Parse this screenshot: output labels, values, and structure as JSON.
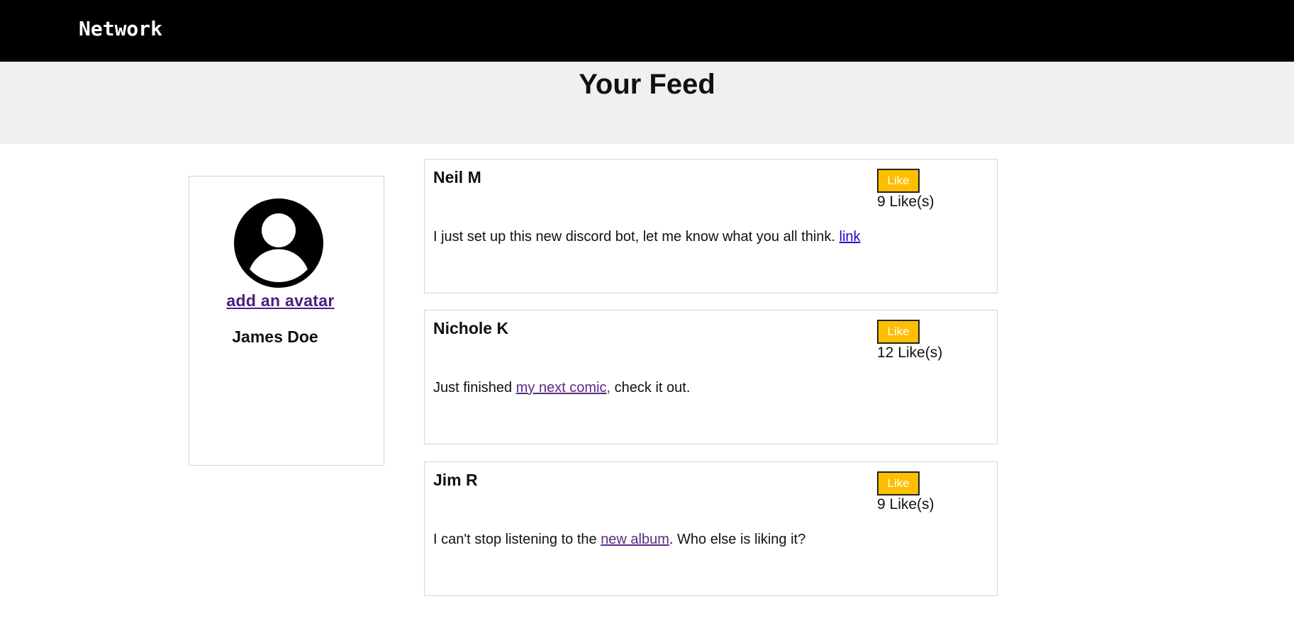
{
  "brand": {
    "label": "Network"
  },
  "header": {
    "title": "Your Feed"
  },
  "profile": {
    "avatar_icon": "user-avatar-icon",
    "add_avatar_label": "add an avatar",
    "name": "James Doe"
  },
  "like_button_label": "Like",
  "posts": [
    {
      "author": "Neil M",
      "likes": "9 Like(s)",
      "text_before": "I just set up this new discord bot, let me know what you all think. ",
      "link": "link",
      "text_after": ""
    },
    {
      "author": "Nichole K",
      "likes": "12 Like(s)",
      "text_before": "Just finished ",
      "link": "my next comic,",
      "text_after": " check it out."
    },
    {
      "author": "Jim R",
      "likes": "9 Like(s)",
      "text_before": "I can't stop listening to the ",
      "link": "new album",
      "text_after": ". Who else is liking it?"
    }
  ],
  "colors": {
    "topbar": "#000000",
    "hero": "#f0f0f0",
    "like_button": "#ffbf00",
    "visited_link": "#5b2a86",
    "unvisited_link": "#1a0dcc"
  }
}
